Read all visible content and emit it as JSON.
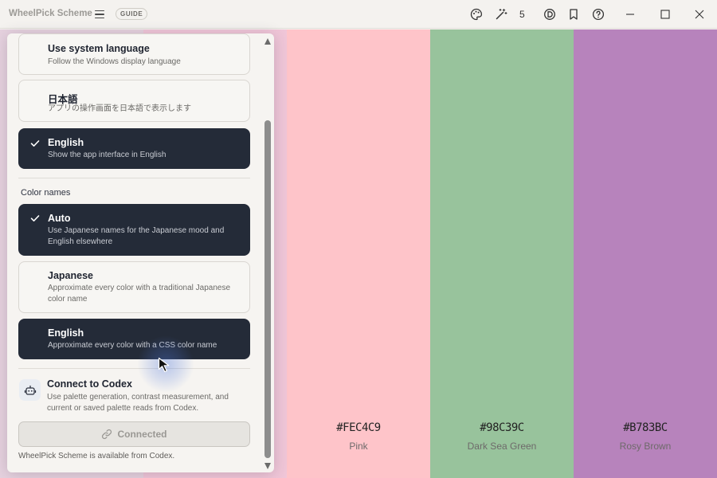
{
  "window": {
    "title": "WheelPick Scheme",
    "guide_label": "GUIDE",
    "saved_count": "5",
    "toolbar_icons": [
      "palette-icon",
      "magic-wand-icon",
      "color-blind-icon",
      "bookmark-icon",
      "help-icon"
    ],
    "window_controls": [
      "minimize-icon",
      "maximize-icon",
      "close-icon"
    ]
  },
  "settings": {
    "language_options": [
      {
        "title": "Use system language",
        "description": "Follow the Windows display language",
        "selected": false
      },
      {
        "title": "日本語",
        "description": "アプリの操作画面を日本語で表示します",
        "selected": false
      },
      {
        "title": "English",
        "description": "Show the app interface in English",
        "selected": true
      }
    ],
    "color_names_label": "Color names",
    "color_name_options": [
      {
        "title": "Auto",
        "description": "Use Japanese names for the Japanese mood and English elsewhere",
        "selected": true
      },
      {
        "title": "Japanese",
        "description": "Approximate every color with a traditional Japanese color name",
        "selected": false
      },
      {
        "title": "English",
        "description": "Approximate every color with a CSS color name",
        "selected": false
      }
    ],
    "codex": {
      "title": "Connect to Codex",
      "description": "Use palette generation, contrast measurement, and current or saved palette reads from Codex.",
      "button_label": "Connected",
      "note": "WheelPick Scheme is available from Codex."
    }
  },
  "palette": [
    {
      "hex": "#FEC4C9",
      "name": "Pink",
      "color": "#FEC4C9"
    },
    {
      "hex": "#98C39C",
      "name": "Dark Sea Green",
      "color": "#98C39C"
    },
    {
      "hex": "#B783BC",
      "name": "Rosy Brown",
      "color": "#B783BC"
    }
  ],
  "colors": {
    "selected_bg": "#242B38",
    "left_strip": "#E8C8DC"
  }
}
